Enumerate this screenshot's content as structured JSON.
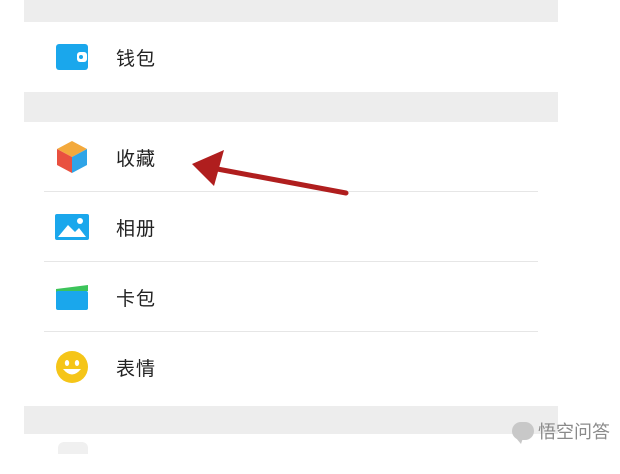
{
  "menu": {
    "wallet": {
      "label": "钱包",
      "icon": "wallet-icon",
      "color": "#1aa7ec"
    },
    "favorites": {
      "label": "收藏",
      "icon": "cube-icon"
    },
    "album": {
      "label": "相册",
      "icon": "image-icon",
      "color": "#1aa7ec"
    },
    "cards": {
      "label": "卡包",
      "icon": "card-icon",
      "color": "#1aa7ec"
    },
    "stickers": {
      "label": "表情",
      "icon": "smiley-icon",
      "color": "#f5c518"
    }
  },
  "annotation": {
    "arrow_color": "#b01e1e"
  },
  "watermark": {
    "text": "悟空问答"
  }
}
